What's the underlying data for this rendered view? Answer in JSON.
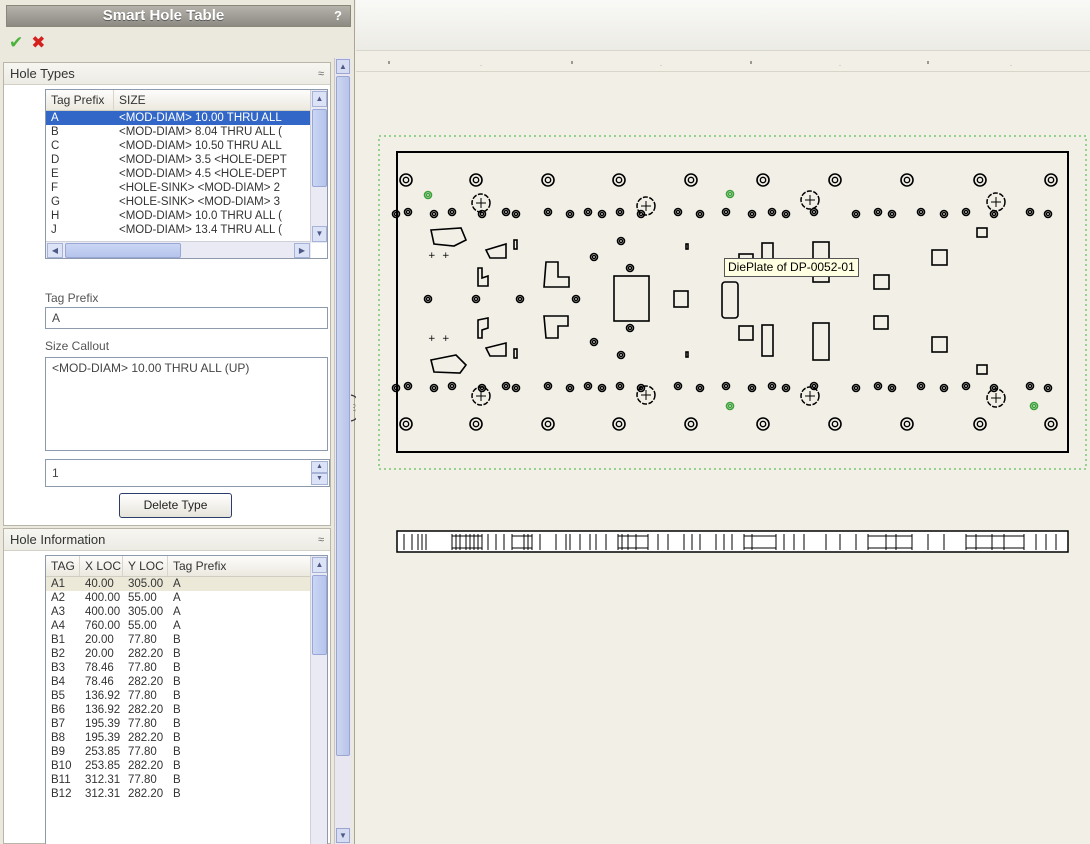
{
  "panel": {
    "title": "Smart Hole Table",
    "help": "?",
    "ok": "✔",
    "cancel": "✖"
  },
  "hole_types": {
    "title": "Hole Types",
    "columns": [
      "Tag Prefix",
      "SIZE"
    ],
    "rows": [
      {
        "prefix": "A",
        "size": "<MOD-DIAM> 10.00 THRU ALL"
      },
      {
        "prefix": "B",
        "size": "<MOD-DIAM> 8.04 THRU ALL ("
      },
      {
        "prefix": "C",
        "size": "<MOD-DIAM> 10.50 THRU ALL"
      },
      {
        "prefix": "D",
        "size": "<MOD-DIAM> 3.5 <HOLE-DEPT"
      },
      {
        "prefix": "E",
        "size": "<MOD-DIAM> 4.5 <HOLE-DEPT"
      },
      {
        "prefix": "F",
        "size": "<HOLE-SINK> <MOD-DIAM> 2"
      },
      {
        "prefix": "G",
        "size": "<HOLE-SINK> <MOD-DIAM> 3"
      },
      {
        "prefix": "H",
        "size": "<MOD-DIAM> 10.0 THRU ALL ("
      },
      {
        "prefix": "J",
        "size": "<MOD-DIAM> 13.4 THRU ALL ("
      }
    ],
    "selected_index": 0,
    "tag_prefix_label": "Tag Prefix",
    "tag_prefix_value": "A",
    "size_callout_label": "Size Callout",
    "size_callout_value": "<MOD-DIAM> 10.00 THRU ALL (UP)",
    "count_value": "1",
    "delete_button": "Delete Type"
  },
  "hole_info": {
    "title": "Hole Information",
    "columns": [
      "TAG",
      "X LOC",
      "Y LOC",
      "Tag Prefix"
    ],
    "rows": [
      {
        "tag": "A1",
        "x": "40.00",
        "y": "305.00",
        "prefix": "A"
      },
      {
        "tag": "A2",
        "x": "400.00",
        "y": "55.00",
        "prefix": "A"
      },
      {
        "tag": "A3",
        "x": "400.00",
        "y": "305.00",
        "prefix": "A"
      },
      {
        "tag": "A4",
        "x": "760.00",
        "y": "55.00",
        "prefix": "A"
      },
      {
        "tag": "B1",
        "x": "20.00",
        "y": "77.80",
        "prefix": "B"
      },
      {
        "tag": "B2",
        "x": "20.00",
        "y": "282.20",
        "prefix": "B"
      },
      {
        "tag": "B3",
        "x": "78.46",
        "y": "77.80",
        "prefix": "B"
      },
      {
        "tag": "B4",
        "x": "78.46",
        "y": "282.20",
        "prefix": "B"
      },
      {
        "tag": "B5",
        "x": "136.92",
        "y": "77.80",
        "prefix": "B"
      },
      {
        "tag": "B6",
        "x": "136.92",
        "y": "282.20",
        "prefix": "B"
      },
      {
        "tag": "B7",
        "x": "195.39",
        "y": "77.80",
        "prefix": "B"
      },
      {
        "tag": "B8",
        "x": "195.39",
        "y": "282.20",
        "prefix": "B"
      },
      {
        "tag": "B9",
        "x": "253.85",
        "y": "77.80",
        "prefix": "B"
      },
      {
        "tag": "B10",
        "x": "253.85",
        "y": "282.20",
        "prefix": "B"
      },
      {
        "tag": "B11",
        "x": "312.31",
        "y": "77.80",
        "prefix": "B"
      },
      {
        "tag": "B12",
        "x": "312.31",
        "y": "282.20",
        "prefix": "B"
      }
    ],
    "selected_index": 0
  },
  "canvas": {
    "tooltip": "DiePlate of DP-0052-01",
    "colors": {
      "outline": "#000000",
      "selection_box": "#3bb33b",
      "highlight_hole": "#3aa03a"
    }
  }
}
